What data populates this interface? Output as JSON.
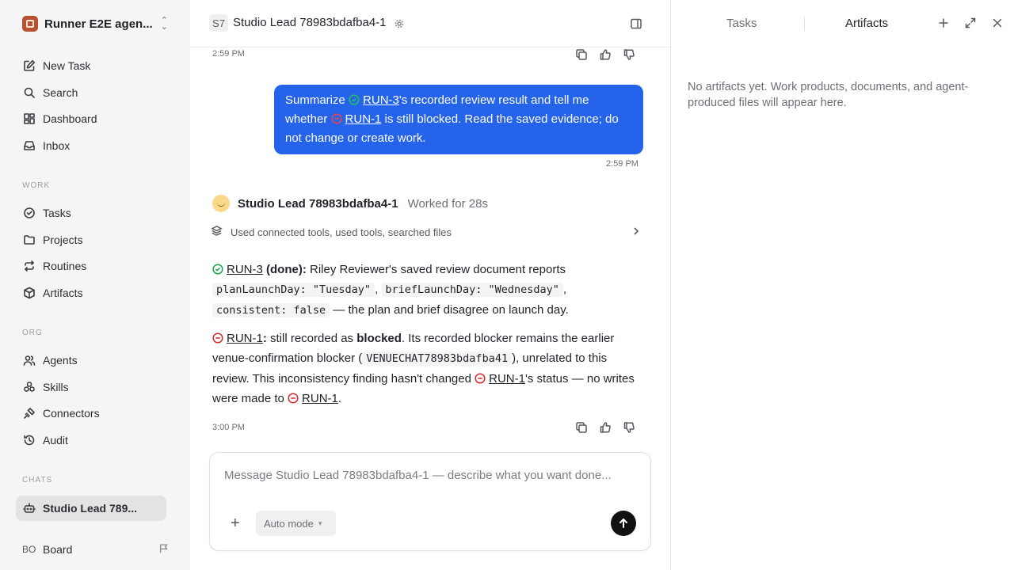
{
  "workspace": {
    "name": "Runner E2E agen..."
  },
  "nav": {
    "top": [
      {
        "label": "New Task",
        "icon": "edit-icon"
      },
      {
        "label": "Search",
        "icon": "search-icon"
      },
      {
        "label": "Dashboard",
        "icon": "dashboard-icon"
      },
      {
        "label": "Inbox",
        "icon": "inbox-icon"
      }
    ],
    "work_label": "WORK",
    "work": [
      {
        "label": "Tasks",
        "icon": "check-circle-icon"
      },
      {
        "label": "Projects",
        "icon": "folder-icon"
      },
      {
        "label": "Routines",
        "icon": "repeat-icon"
      },
      {
        "label": "Artifacts",
        "icon": "box-icon"
      }
    ],
    "org_label": "ORG",
    "org": [
      {
        "label": "Agents",
        "icon": "users-icon"
      },
      {
        "label": "Skills",
        "icon": "skills-icon"
      },
      {
        "label": "Connectors",
        "icon": "plug-icon"
      },
      {
        "label": "Audit",
        "icon": "history-icon"
      }
    ],
    "chats_label": "CHATS",
    "chats": [
      {
        "label": "Studio Lead 789...",
        "icon": "bot-icon"
      }
    ],
    "board": {
      "initials": "BO",
      "label": "Board"
    }
  },
  "chat_header": {
    "badge": "S7",
    "title": "Studio Lead 78983bdafba4-1"
  },
  "messages": {
    "prev_time": "2:59 PM",
    "user": {
      "p1": "Summarize ",
      "link1": "RUN-3",
      "p2": "'s recorded review result and tell me whether ",
      "link2": "RUN-1",
      "p3": " is still blocked. Read the saved evidence; do not change or create work.",
      "time": "2:59 PM"
    },
    "agent": {
      "name": "Studio Lead 78983bdafba4-1",
      "worked": "Worked for 28s",
      "tools_summary": "Used connected tools, used tools, searched files",
      "para1": {
        "link": "RUN-3",
        "status": " (done):",
        "t1": " Riley Reviewer's saved review document reports ",
        "code1": "planLaunchDay: \"Tuesday\"",
        "sep1": ", ",
        "code2": "briefLaunchDay: \"Wednesday\"",
        "sep2": ", ",
        "code3": "consistent: false",
        "t2": " — the plan and brief disagree on launch day."
      },
      "para2": {
        "link": "RUN-1",
        "colon": ":",
        "t1": " still recorded as ",
        "bold": "blocked",
        "t2": ". Its recorded blocker remains the earlier venue-confirmation blocker (",
        "code": "VENUECHAT78983bdafba41",
        "t3": "), unrelated to this review. This inconsistency finding hasn't changed ",
        "link2": "RUN-1",
        "t4": "'s status — no writes were made to ",
        "link3": "RUN-1",
        "t5": "."
      },
      "time": "3:00 PM"
    }
  },
  "composer": {
    "placeholder": "Message Studio Lead 78983bdafba4-1 — describe what you want done...",
    "mode": "Auto mode"
  },
  "right_panel": {
    "tabs": [
      "Tasks",
      "Artifacts"
    ],
    "active_tab": "Artifacts",
    "empty_text": "No artifacts yet. Work products, documents, and agent-produced files will appear here."
  },
  "colors": {
    "accent": "#2563eb",
    "done": "#16a34a",
    "blocked": "#dc2626",
    "sidebar_bg": "#f5f5f5"
  }
}
